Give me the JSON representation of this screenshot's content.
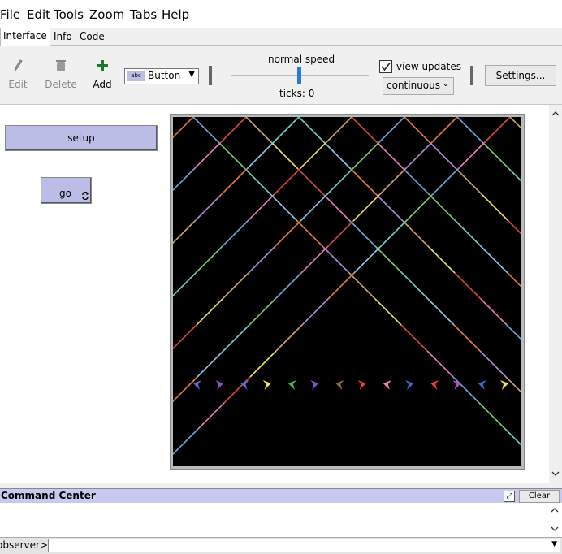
{
  "menu": [
    "File",
    "Edit",
    "Tools",
    "Zoom",
    "Tabs",
    "Help"
  ],
  "tabs": [
    "Interface",
    "Info",
    "Code"
  ],
  "toolbar": {
    "edit_label": "Edit",
    "delete_label": "Delete",
    "add_label": "Add",
    "widget_type": "Button",
    "widget_icon_text": "abc",
    "speed_label": "normal speed",
    "speed_fraction": 0.5,
    "ticks_label": "ticks: 0",
    "view_updates_label": "view updates",
    "view_updates_checked": true,
    "update_mode": "continuous",
    "settings_label": "Settings..."
  },
  "widgets": {
    "setup_label": "setup",
    "go_label": "go",
    "button_color": "#bcbde6"
  },
  "view": {
    "background": "#000000",
    "turtle_colors": [
      "#5b6fd1",
      "#8a4fc7",
      "#5b6fd1",
      "#f5e642",
      "#3ec144",
      "#8a4fc7",
      "#8b6a40",
      "#ee3b3b",
      "#f28ba0",
      "#3e6ed6",
      "#ee3b3b",
      "#b84bc2",
      "#3e6ed6",
      "#f5e642"
    ],
    "trail_colors": [
      "#6aa6d8",
      "#e9e25a",
      "#e37a3a",
      "#7ecb6a",
      "#d24848",
      "#b48ad8",
      "#6fd0c8",
      "#e97ab5",
      "#c9a36a",
      "#8ec6e6"
    ]
  },
  "command_center": {
    "title": "Command Center",
    "clear_label": "Clear",
    "prompt": "observer>",
    "input_value": ""
  }
}
